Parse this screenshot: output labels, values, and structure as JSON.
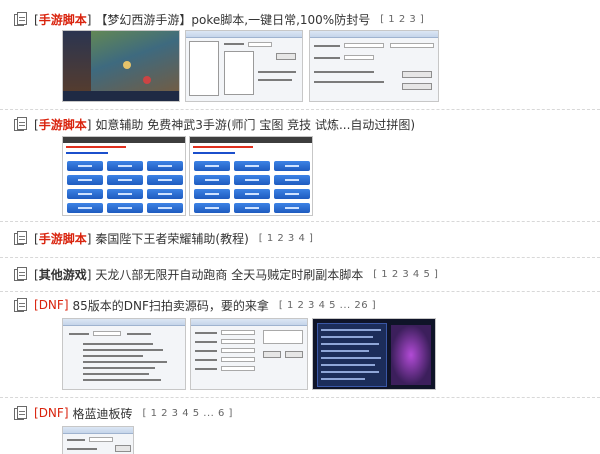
{
  "threads": [
    {
      "category": "手游脚本",
      "category_style": "red",
      "title": "【梦幻西游手游】poke脚本,一键日常,100%防封号",
      "pages": "[ 1 2 3 ]",
      "thumbnails": [
        "game-screenshot",
        "script-window",
        "script-window"
      ]
    },
    {
      "category": "手游脚本",
      "category_style": "red",
      "title": "如意辅助 免费神武3手游(师门 宝图 竞技 试炼...自动过拼图)",
      "pages": "",
      "thumbnails": [
        "mobile-menu",
        "mobile-menu"
      ]
    },
    {
      "category": "手游脚本",
      "category_style": "red",
      "title": "秦国陛下王者荣耀辅助(教程)",
      "pages": "[ 1 2 3 4 ]",
      "thumbnails": []
    },
    {
      "category": "其他游戏",
      "category_style": "dark",
      "title": "天龙八部无限开自动跑商 全天马贼定时刷副本脚本",
      "pages": "[ 1 2 3 4 5 ]",
      "thumbnails": []
    },
    {
      "category": "DNF",
      "category_style": "dnf",
      "title": "85版本的DNF扫拍卖源码，要的来拿",
      "pages": "[ 1 2 3 4 5 ... 26 ]",
      "thumbnails": [
        "settings-window",
        "settings-window",
        "dark-game-ui"
      ]
    },
    {
      "category": "DNF",
      "category_style": "dnf",
      "title": "格蓝迪板砖",
      "pages": "[ 1 2 3 4 5 ... 6 ]",
      "thumbnails": [
        "settings-window"
      ]
    }
  ]
}
